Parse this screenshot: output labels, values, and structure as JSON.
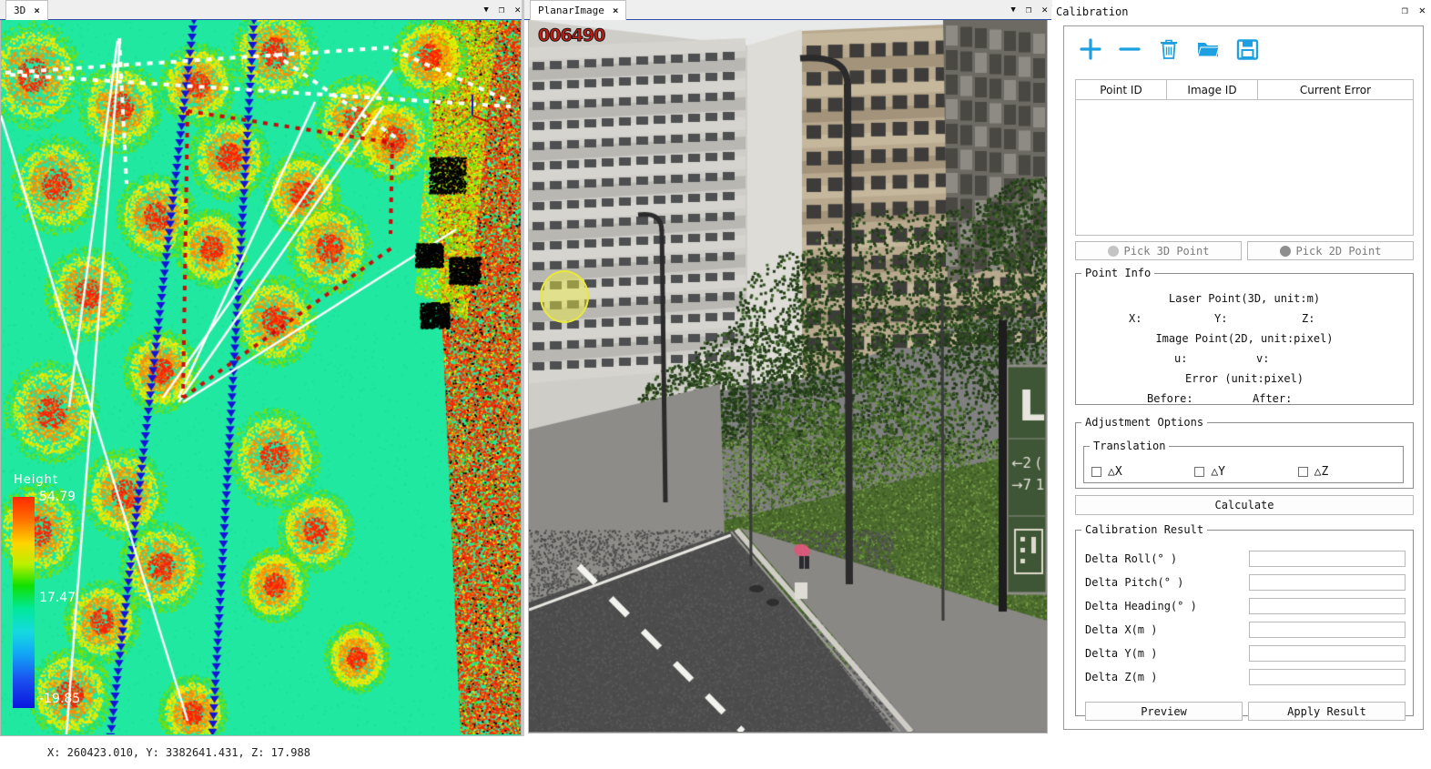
{
  "window": {
    "left_dock": {
      "tab_label": "3D",
      "tab_close": "×",
      "menu_icon": "▼",
      "float_icon": "❐",
      "close_icon": "✕"
    },
    "image_dock": {
      "tab_label": "PlanarImage",
      "tab_close": "×",
      "menu_icon": "▼",
      "float_icon": "❐",
      "close_icon": "✕"
    }
  },
  "view3d": {
    "legend_title": "Height",
    "legend_max": "54.79",
    "legend_mid": "17.47",
    "legend_min": "-19.85"
  },
  "planar_image": {
    "frame_id": "006490",
    "pick_marker_name": "picked-2d-point-marker"
  },
  "status_bar": {
    "coords": "X: 260423.010, Y: 3382641.431, Z: 17.988"
  },
  "calibration": {
    "title": "Calibration",
    "float_icon": "❐",
    "close_icon": "✕",
    "accent_color": "#1e9fe0",
    "toolbar": [
      {
        "name": "add-point-icon",
        "label": "+"
      },
      {
        "name": "remove-point-icon",
        "label": "−"
      },
      {
        "name": "delete-icon",
        "label": "trash"
      },
      {
        "name": "open-folder-icon",
        "label": "open"
      },
      {
        "name": "save-icon",
        "label": "save"
      }
    ],
    "table": {
      "columns": [
        "Point ID",
        "Image ID",
        "Current Error"
      ],
      "rows": []
    },
    "pick_buttons": [
      {
        "label": "Pick 3D Point",
        "name": "pick-3d-point-button"
      },
      {
        "label": "Pick 2D Point",
        "name": "pick-2d-point-button"
      }
    ],
    "point_info": {
      "legend": "Point Info",
      "laser_header": "Laser Point(3D, unit:m)",
      "laser_x": "X:",
      "laser_y": "Y:",
      "laser_z": "Z:",
      "image_header": "Image Point(2D, unit:pixel)",
      "image_u": "u:",
      "image_v": "v:",
      "error_header": "Error (unit:pixel)",
      "error_before": "Before:",
      "error_after": "After:"
    },
    "adjustment": {
      "legend": "Adjustment Options",
      "translation_legend": "Translation",
      "checkboxes": [
        {
          "label": "△X",
          "checked": false
        },
        {
          "label": "△Y",
          "checked": false
        },
        {
          "label": "△Z",
          "checked": false
        }
      ]
    },
    "calculate_label": "Calculate",
    "result": {
      "legend": "Calibration Result",
      "fields": [
        {
          "label": "Delta Roll(° )",
          "value": ""
        },
        {
          "label": "Delta Pitch(° )",
          "value": ""
        },
        {
          "label": "Delta Heading(° )",
          "value": ""
        },
        {
          "label": "Delta X(m )",
          "value": ""
        },
        {
          "label": "Delta Y(m )",
          "value": ""
        },
        {
          "label": "Delta Z(m )",
          "value": ""
        }
      ],
      "preview_label": "Preview",
      "apply_label": "Apply Result"
    }
  }
}
